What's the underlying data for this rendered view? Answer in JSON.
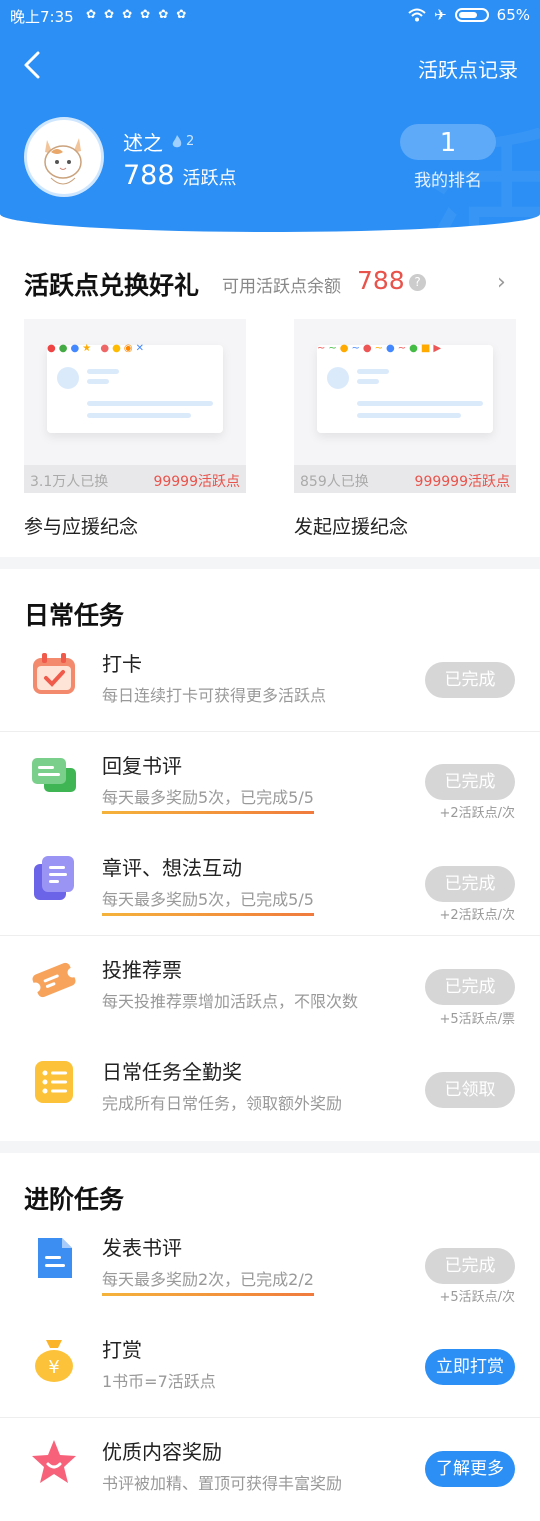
{
  "status_bar": {
    "time": "晚上7:35",
    "battery": "65%"
  },
  "header": {
    "title_link": "活跃点记录"
  },
  "user": {
    "name": "述之",
    "level": "2",
    "points": "788",
    "points_unit": "活跃点",
    "rank": "1",
    "rank_label": "我的排名"
  },
  "exchange": {
    "title": "活跃点兑换好礼",
    "available_label": "可用活跃点余额",
    "available_value": "788",
    "gifts": [
      {
        "taken": "3.1万人已换",
        "price": "99999活跃点",
        "name": "参与应援纪念"
      },
      {
        "taken": "859人已换",
        "price": "999999活跃点",
        "name": "发起应援纪念"
      }
    ]
  },
  "daily": {
    "title": "日常任务",
    "tasks": [
      {
        "name": "打卡",
        "desc": "每日连续打卡可获得更多活跃点",
        "button": "已完成",
        "reward": "",
        "icon": "calendar-icon"
      },
      {
        "name": "回复书评",
        "desc": "每天最多奖励5次，已完成5/5",
        "button": "已完成",
        "reward": "+2活跃点/次",
        "icon": "chat-bubbles-icon"
      },
      {
        "name": "章评、想法互动",
        "desc": "每天最多奖励5次，已完成5/5",
        "button": "已完成",
        "reward": "+2活跃点/次",
        "icon": "notes-icon"
      },
      {
        "name": "投推荐票",
        "desc": "每天投推荐票增加活跃点，不限次数",
        "button": "已完成",
        "reward": "+5活跃点/票",
        "icon": "ticket-icon"
      },
      {
        "name": "日常任务全勤奖",
        "desc": "完成所有日常任务，领取额外奖励",
        "button": "已领取",
        "reward": "",
        "icon": "checklist-icon"
      }
    ]
  },
  "advanced": {
    "title": "进阶任务",
    "tasks": [
      {
        "name": "发表书评",
        "desc": "每天最多奖励2次，已完成2/2",
        "button": "已完成",
        "reward": "+5活跃点/次",
        "icon": "document-icon"
      },
      {
        "name": "打赏",
        "desc": "1书币=7活跃点",
        "button": "立即打赏",
        "reward": "",
        "icon": "money-bag-icon"
      },
      {
        "name": "优质内容奖励",
        "desc": "书评被加精、置顶可获得丰富奖励",
        "button": "了解更多",
        "reward": "",
        "icon": "star-icon"
      }
    ]
  },
  "colors": {
    "primary": "#2b8ff5",
    "highlight": "#e8534b",
    "done_button": "#d6d6d6"
  }
}
